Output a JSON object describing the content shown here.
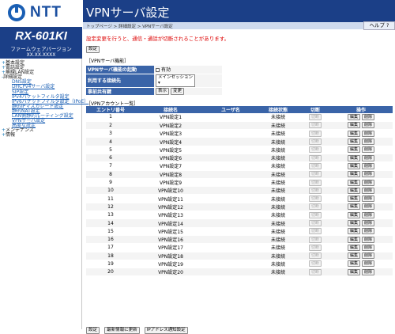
{
  "logo": {
    "brand": "NTT"
  },
  "device": {
    "model": "RX-601KI",
    "fw_label": "ファームウェアバージョン",
    "fw_version": "XX.XX.XXXX"
  },
  "menu": [
    {
      "level": 1,
      "mark": "+",
      "label": "基本設定"
    },
    {
      "level": 1,
      "mark": "+",
      "label": "電話設定"
    },
    {
      "level": 1,
      "mark": "+",
      "label": "無線LAN設定"
    },
    {
      "level": 1,
      "mark": "-",
      "label": "詳細設定"
    },
    {
      "level": 3,
      "label": "DNS設定"
    },
    {
      "level": 3,
      "label": "DHCPv4サーバ設定"
    },
    {
      "level": 3,
      "label": "SIP設定"
    },
    {
      "level": 3,
      "label": "IPv4パケットフィルタ設定"
    },
    {
      "level": 3,
      "label": "IPv6パケットフィルタ設定（IPoE）"
    },
    {
      "level": 3,
      "label": "静的IPマスカレード設定"
    },
    {
      "level": 3,
      "label": "静的NAT設定"
    },
    {
      "level": 3,
      "label": "LAN側静的ルーティング設定"
    },
    {
      "level": 3,
      "label": "VPNサーバ設定"
    },
    {
      "level": 3,
      "label": "高度な設定"
    },
    {
      "level": 1,
      "mark": "+",
      "label": "メンテナンス"
    },
    {
      "level": 1,
      "mark": "+",
      "label": "情報"
    }
  ],
  "header": {
    "title": "VPNサーバ設定",
    "breadcrumb": "トップページ > 詳細設定 > VPNサーバ設定",
    "help": "ヘルプ ?"
  },
  "notice": "設定変更を行うと、通信・通話が切断されることがあります。",
  "top_set_label": "設定",
  "server_section": {
    "heading": "［VPNサーバ機能］",
    "rows": [
      {
        "key": "VPNサーバ機能の起動",
        "value": "有効"
      },
      {
        "key": "利用する接続先",
        "value": "メインセッション"
      },
      {
        "key": "事前共有鍵",
        "show": "表示",
        "change": "変更"
      }
    ]
  },
  "account_section": {
    "heading": "［VPNアカウント一覧］",
    "headers": [
      "エントリ番号",
      "接続名",
      "ユーザ名",
      "接続状態",
      "切断",
      "操作"
    ],
    "disconnect_label": "切断",
    "edit_label": "編集",
    "delete_label": "削除",
    "rows": [
      {
        "no": "1",
        "name": "VPN設定1",
        "user": "",
        "status": "未接続"
      },
      {
        "no": "2",
        "name": "VPN設定2",
        "user": "",
        "status": "未接続"
      },
      {
        "no": "3",
        "name": "VPN設定3",
        "user": "",
        "status": "未接続"
      },
      {
        "no": "4",
        "name": "VPN設定4",
        "user": "",
        "status": "未接続"
      },
      {
        "no": "5",
        "name": "VPN設定5",
        "user": "",
        "status": "未接続"
      },
      {
        "no": "6",
        "name": "VPN設定6",
        "user": "",
        "status": "未接続"
      },
      {
        "no": "7",
        "name": "VPN設定7",
        "user": "",
        "status": "未接続"
      },
      {
        "no": "8",
        "name": "VPN設定8",
        "user": "",
        "status": "未接続"
      },
      {
        "no": "9",
        "name": "VPN設定9",
        "user": "",
        "status": "未接続"
      },
      {
        "no": "10",
        "name": "VPN設定10",
        "user": "",
        "status": "未接続"
      },
      {
        "no": "11",
        "name": "VPN設定11",
        "user": "",
        "status": "未接続"
      },
      {
        "no": "12",
        "name": "VPN設定12",
        "user": "",
        "status": "未接続"
      },
      {
        "no": "13",
        "name": "VPN設定13",
        "user": "",
        "status": "未接続"
      },
      {
        "no": "14",
        "name": "VPN設定14",
        "user": "",
        "status": "未接続"
      },
      {
        "no": "15",
        "name": "VPN設定15",
        "user": "",
        "status": "未接続"
      },
      {
        "no": "16",
        "name": "VPN設定16",
        "user": "",
        "status": "未接続"
      },
      {
        "no": "17",
        "name": "VPN設定17",
        "user": "",
        "status": "未接続"
      },
      {
        "no": "18",
        "name": "VPN設定18",
        "user": "",
        "status": "未接続"
      },
      {
        "no": "19",
        "name": "VPN設定19",
        "user": "",
        "status": "未接続"
      },
      {
        "no": "20",
        "name": "VPN設定20",
        "user": "",
        "status": "未接続"
      }
    ]
  },
  "bottom_buttons": {
    "set": "設定",
    "refresh": "最新情報に更新",
    "ip_notify": "IPアドレス通知設定"
  },
  "colors": {
    "brand_blue": "#1b3f87",
    "header_blue": "#3a64a8",
    "notice_red": "#dd0000"
  }
}
